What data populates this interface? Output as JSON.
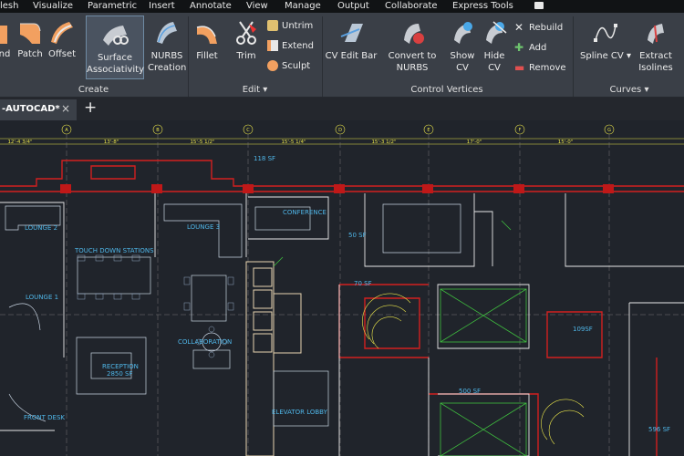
{
  "menu": [
    "lesh",
    "Visualize",
    "Parametric",
    "Insert",
    "Annotate",
    "View",
    "Manage",
    "Output",
    "Collaborate",
    "Express Tools"
  ],
  "ribbon": {
    "create_buttons": [
      "nd",
      "Patch",
      "Offset"
    ],
    "surface_assoc": [
      "Surface",
      "Associativity"
    ],
    "nurbs_creation": [
      "NURBS",
      "Creation"
    ],
    "create_panel": "Create",
    "fillet": "Fillet",
    "trim": "Trim",
    "untrim": "Untrim",
    "extend": "Extend",
    "sculpt": "Sculpt",
    "edit_panel": "Edit",
    "cv_edit_bar": "CV Edit Bar",
    "convert_nurbs": [
      "Convert to",
      "NURBS"
    ],
    "show_cv": [
      "Show",
      "CV"
    ],
    "hide_cv": [
      "Hide",
      "CV"
    ],
    "rebuild": "Rebuild",
    "add": "Add",
    "remove": "Remove",
    "control_vertices_panel": "Control Vertices",
    "spline_cv": "Spline CV",
    "extract_isolines": [
      "Extract",
      "Isolines"
    ],
    "curves_panel": "Curves"
  },
  "tabs": {
    "document": "-AUTOCAD*",
    "close": "×",
    "new": "+"
  },
  "drawing": {
    "grid_marks": [
      "A",
      "B",
      "C",
      "D",
      "E",
      "F",
      "G"
    ],
    "dims": [
      "12'-4 3/4\"",
      "13'-8\"",
      "15'-5 1/2\"",
      "15'-5 1/4\"",
      "15'-3 1/2\"",
      "17'-0\"",
      "15'-0\""
    ],
    "rooms": {
      "sf118": "118 SF",
      "lounge2": "LOUNGE 2",
      "lounge3": "LOUNGE 3",
      "conference": "CONFERENCE",
      "touchdown": "TOUCH DOWN STATIONS",
      "sf50": "50 SF",
      "lounge1": "LOUNGE 1",
      "sf70": "70 SF",
      "collaboration": "COLLABORATION",
      "sf109": "109SF",
      "reception": "RECEPTION",
      "sf2850": "2850 SF",
      "sf500": "500 SF",
      "front_desk": "FRONT DESK",
      "elevator_lobby": "ELEVATOR LOBBY",
      "sf596": "596 SF"
    }
  },
  "colors": {
    "ribbon": "#3a3f47",
    "canvas": "#20242b",
    "wall_red": "#d22020",
    "label_blue": "#4fb6e8",
    "dim_yellow": "#e8e34a"
  }
}
